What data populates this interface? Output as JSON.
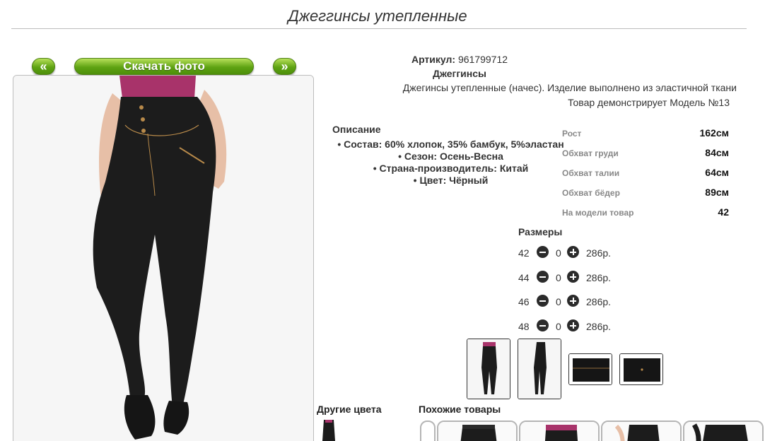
{
  "product": {
    "title": "Джеггинсы утепленные",
    "article_label": "Артикул:",
    "article_value": "961799712",
    "category": "Джеггинсы",
    "description": "Джегинсы утепленные (начес). Изделие выполнено из эластичной ткани",
    "model_note": "Товар демонстрирует Модель №13"
  },
  "gallery": {
    "prev_label": "«",
    "next_label": "»",
    "download_label": "Скачать фото"
  },
  "description_section": {
    "heading": "Описание",
    "items": [
      "Состав: 60% хлопок, 35% бамбук, 5%эластан",
      "Сезон: Осень-Весна",
      "Страна-производитель: Китай",
      "Цвет: Чёрный"
    ]
  },
  "measurements": [
    {
      "label": "Рост",
      "value": "162см"
    },
    {
      "label": "Обхват груди",
      "value": "84см"
    },
    {
      "label": "Обхват талии",
      "value": "64см"
    },
    {
      "label": "Обхват бёдер",
      "value": "89см"
    },
    {
      "label": "На модели товар",
      "value": "42"
    }
  ],
  "sizes": {
    "heading": "Размеры",
    "rows": [
      {
        "size": "42",
        "qty": "0",
        "price": "286р."
      },
      {
        "size": "44",
        "qty": "0",
        "price": "286р."
      },
      {
        "size": "46",
        "qty": "0",
        "price": "286р."
      },
      {
        "size": "48",
        "qty": "0",
        "price": "286р."
      }
    ]
  },
  "sections": {
    "other_colors": "Другие цвета",
    "similar_products": "Похожие товары"
  },
  "colors": {
    "fabric": "#1c1c1c",
    "top": "#a8336a",
    "skin": "#e7bfa7",
    "button": "#5ea312",
    "stitch": "#b88a4a"
  }
}
